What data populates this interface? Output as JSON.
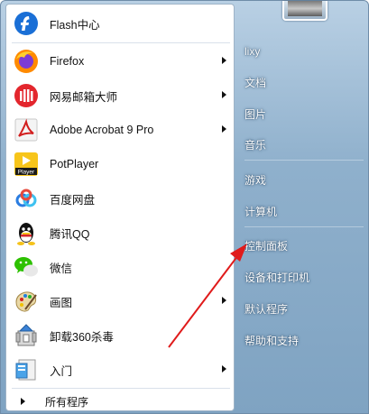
{
  "left_items": [
    {
      "label": "Flash中心",
      "icon": "flash-icon",
      "arrow": false
    },
    {
      "label": "Firefox",
      "icon": "firefox-icon",
      "arrow": true
    },
    {
      "label": "网易邮箱大师",
      "icon": "netease-mail-icon",
      "arrow": true
    },
    {
      "label": "Adobe Acrobat 9 Pro",
      "icon": "acrobat-icon",
      "arrow": true
    },
    {
      "label": "PotPlayer",
      "icon": "potplayer-icon",
      "arrow": false
    },
    {
      "label": "百度网盘",
      "icon": "baidu-netdisk-icon",
      "arrow": false
    },
    {
      "label": "腾讯QQ",
      "icon": "qq-icon",
      "arrow": false
    },
    {
      "label": "微信",
      "icon": "wechat-icon",
      "arrow": false
    },
    {
      "label": "画图",
      "icon": "paint-icon",
      "arrow": true
    },
    {
      "label": "卸载360杀毒",
      "icon": "uninstall-360-icon",
      "arrow": false
    },
    {
      "label": "入门",
      "icon": "getting-started-icon",
      "arrow": true
    }
  ],
  "potplayer_icon_text": "Player",
  "all_programs_label": "所有程序",
  "right_items": [
    "lixy",
    "文档",
    "图片",
    "音乐",
    "游戏",
    "计算机",
    "控制面板",
    "设备和打印机",
    "默认程序",
    "帮助和支持"
  ],
  "colors": {
    "menu_blue": "#8fb0cc",
    "annotation_arrow": "#e01b1b"
  }
}
